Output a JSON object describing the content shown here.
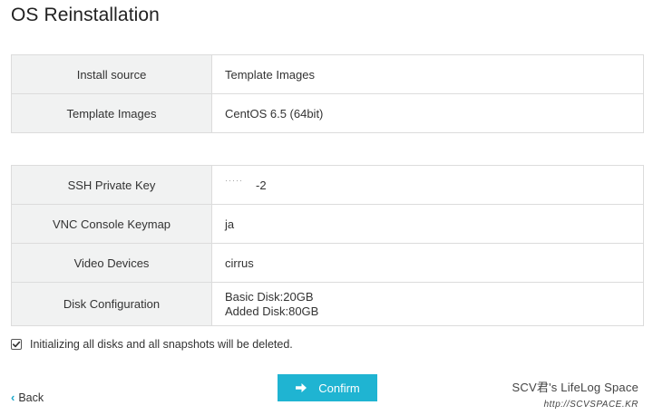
{
  "page": {
    "title": "OS Reinstallation"
  },
  "install_table": {
    "rows": [
      {
        "label": "Install source",
        "value": "Template Images"
      },
      {
        "label": "Template Images",
        "value": "CentOS 6.5 (64bit)"
      }
    ]
  },
  "config_table": {
    "rows": [
      {
        "label": "SSH Private Key",
        "value": "-2"
      },
      {
        "label": "VNC Console Keymap",
        "value": "ja"
      },
      {
        "label": "Video Devices",
        "value": "cirrus"
      },
      {
        "label": "Disk Configuration",
        "value_lines": [
          "Basic Disk:20GB",
          "Added Disk:80GB"
        ]
      }
    ]
  },
  "warning": {
    "checked": true,
    "text": "Initializing all disks and all snapshots will be deleted."
  },
  "actions": {
    "back_label": "Back",
    "confirm_label": "Confirm"
  },
  "watermark": {
    "line1": "SCV君's LifeLog Space",
    "line2": "http://SCVSPACE.KR"
  },
  "colors": {
    "accent": "#1fb4d2",
    "label_bg": "#f1f2f2",
    "border": "#dcdcdc"
  },
  "icons": {
    "back": "chevron-left-icon",
    "confirm": "arrow-right-icon",
    "checkbox": "checkmark-icon"
  }
}
